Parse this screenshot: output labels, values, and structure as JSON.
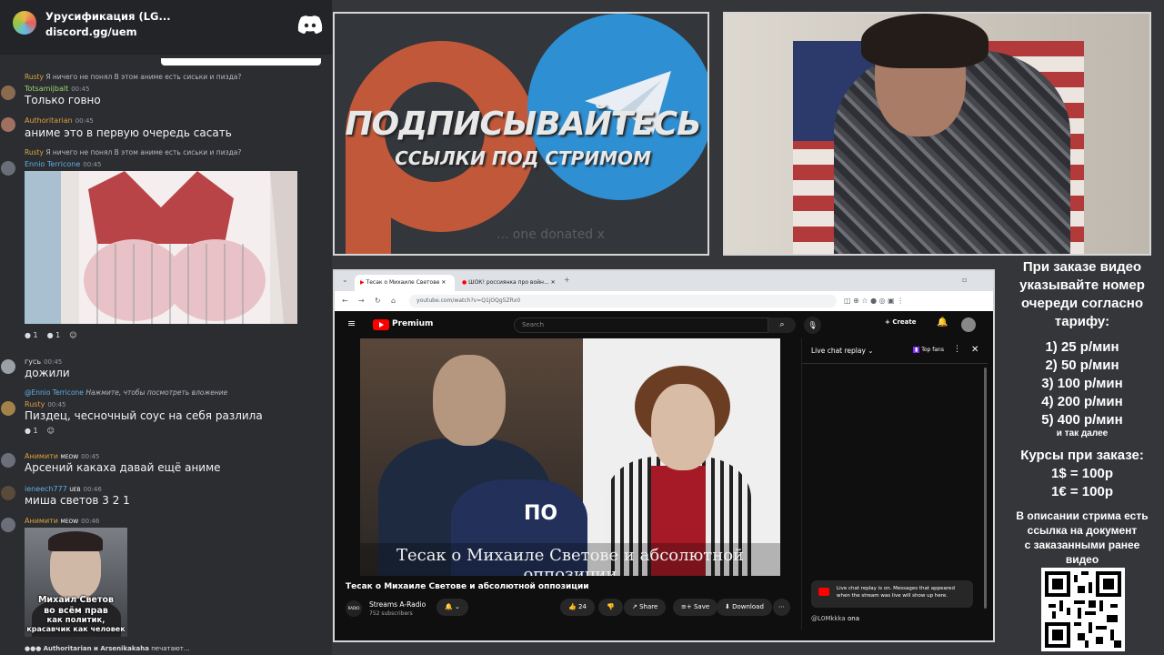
{
  "server": {
    "name": "Урусификация (LG...",
    "invite": "discord.gg/uem"
  },
  "messages": [
    {
      "reply_user": "Rusty",
      "reply_text": "Я ничего не понял В этом аниме есть сиськи и пизда?",
      "user": "Totsamijbalt",
      "time": "00:45",
      "text": "Только говно",
      "color": "#9bd36b"
    },
    {
      "user": "Authoritarian",
      "time": "00:45",
      "text": "аниме это в первую очередь сасать",
      "color": "#e0a03c"
    },
    {
      "reply_user": "Rusty",
      "reply_text": "Я ничего не понял В этом аниме есть сиськи и пизда?",
      "user": "Ennio Terricone",
      "time": "00:45",
      "color": "#5fb0e8"
    },
    {
      "user": "гусь",
      "time": "00:45",
      "text": "дожили",
      "color": "#dbdee1",
      "reactions": [
        "1",
        "1"
      ]
    },
    {
      "reply_user": "@Ennio Terricone",
      "reply_text": "Нажмите, чтобы посмотреть вложение",
      "user": "Rusty",
      "time": "00:45",
      "text": "Пиздец, чесночный соус на себя разлила",
      "color": "#e0a03c",
      "reactions": [
        "1"
      ]
    },
    {
      "user": "Анимити",
      "tag": "MEOW",
      "time": "00:45",
      "text": "Арсений какаха давай ещё аниме",
      "color": "#e0a03c"
    },
    {
      "user": "ieneech777",
      "tag": "UEB",
      "time": "00:46",
      "text": "миша светов 3 2 1",
      "color": "#5fb0e8"
    },
    {
      "user": "Анимити",
      "tag": "MEOW",
      "time": "00:46",
      "color": "#e0a03c"
    }
  ],
  "meme": {
    "line1": "Михаил Светов",
    "line2": "во всём прав",
    "line3": "как политик,",
    "line4": "красавчик как человек"
  },
  "typing": {
    "users": "Authoritarian и Arsenikakaha",
    "suffix": "печатают..."
  },
  "promo": {
    "headline": "ПОДПИСЫВАЙТЕСЬ",
    "subline": "ССЫЛКИ ПОД СТРИМОМ",
    "donated": "... one donated x"
  },
  "browser": {
    "tab1": "Тесак о Михаиле Светове",
    "tab2": "ШОК! россиянка про войн...",
    "url": "youtube.com/watch?v=Q1jOQg5ZRx0"
  },
  "youtube": {
    "premium": "Premium",
    "search_placeholder": "Search",
    "create": "Create",
    "caption": "Тесак о Михаиле Светове и абсолютной оппозиции",
    "title": "Тесак о Михаиле Светове и абсолютной оппозиции",
    "channel": "Streams A-Radio",
    "subs": "752 subscribers",
    "likes": "24",
    "share": "Share",
    "save": "Save",
    "download": "Download",
    "police": "ПО",
    "livechat": "Live chat replay",
    "topfans": "Top fans",
    "note": "Live chat replay is on. Messages that appeared when the stream was live will show up here.",
    "footer_user": "@L0Mkkka",
    "footer_text": "ona"
  },
  "info": {
    "l1": "При заказе видео",
    "l2": "указывайте номер",
    "l3": "очереди согласно",
    "l4": "тарифу:",
    "t1": "1) 25 р/мин",
    "t2": "2) 50 р/мин",
    "t3": "3) 100 р/мин",
    "t4": "4) 200 р/мин",
    "t5": "5) 400 р/мин",
    "t6": "и так далее",
    "c1": "Курсы при заказе:",
    "c2": "1$ = 100р",
    "c3": "1€ = 100р",
    "d1": "В описании стрима есть",
    "d2": "ссылка на документ",
    "d3": "с заказанными ранее",
    "d4": "видео"
  }
}
